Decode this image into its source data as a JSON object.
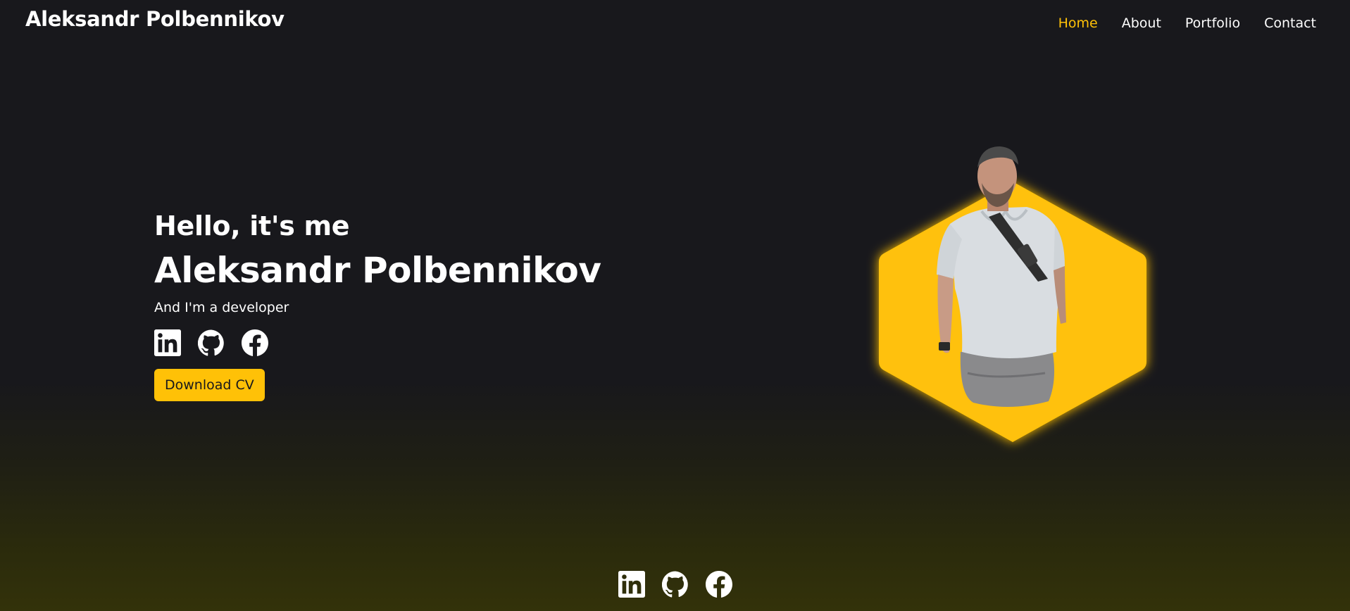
{
  "header": {
    "logo": "Aleksandr Polbennikov",
    "nav": [
      {
        "label": "Home",
        "active": true
      },
      {
        "label": "About",
        "active": false
      },
      {
        "label": "Portfolio",
        "active": false
      },
      {
        "label": "Contact",
        "active": false
      }
    ]
  },
  "hero": {
    "greeting": "Hello, it's me",
    "name": "Aleksandr Polbennikov",
    "role": "And I'm a developer",
    "socials": [
      {
        "icon": "linkedin-icon"
      },
      {
        "icon": "github-icon"
      },
      {
        "icon": "facebook-icon"
      }
    ],
    "cta_label": "Download CV",
    "portrait_icon": "portrait-photo"
  },
  "footer": {
    "socials": [
      {
        "icon": "linkedin-icon"
      },
      {
        "icon": "github-icon"
      },
      {
        "icon": "facebook-icon"
      }
    ]
  },
  "colors": {
    "accent": "#ffc107",
    "background": "#18181c",
    "text": "#ffffff"
  }
}
